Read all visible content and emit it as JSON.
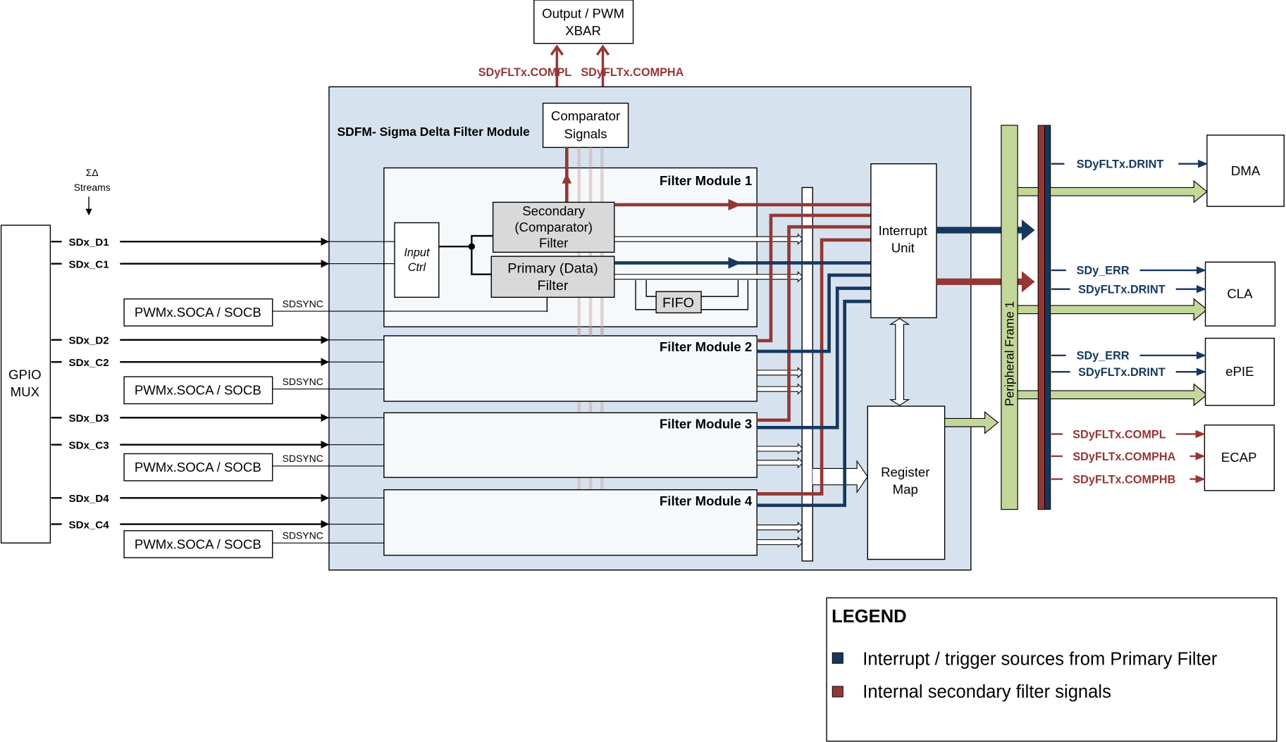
{
  "colors": {
    "interrupt_blue": "#17375e",
    "secondary_red": "#953735",
    "peripheral_green": "#c4d79b",
    "sdfm_background": "#d6e3ef",
    "filter_module_background": "#f5f9fb",
    "filter_box_gray": "#d9d9d9"
  },
  "top": {
    "xbar_line1": "Output / PWM",
    "xbar_line2": "XBAR",
    "compl_label": "SDyFLTx.COMPL",
    "compha_label": "SDyFLTx.COMPHA"
  },
  "inputs": {
    "streams_symbol": "ΣΔ",
    "streams_label": "Streams",
    "gpio_line1": "GPIO",
    "gpio_line2": "MUX",
    "channels": [
      {
        "data": "SDx_D1",
        "clock": "SDx_C1"
      },
      {
        "data": "SDx_D2",
        "clock": "SDx_C2"
      },
      {
        "data": "SDx_D3",
        "clock": "SDx_C3"
      },
      {
        "data": "SDx_D4",
        "clock": "SDx_C4"
      }
    ],
    "pwm_label": "PWMx.SOCA / SOCB",
    "sync_label": "SDSYNC"
  },
  "sdfm": {
    "title": "SDFM- Sigma Delta Filter Module",
    "comparator_line1": "Comparator",
    "comparator_line2": "Signals",
    "filter_modules": [
      "Filter Module 1",
      "Filter Module 2",
      "Filter Module 3",
      "Filter Module 4"
    ],
    "input_ctrl_line1": "Input",
    "input_ctrl_line2": "Ctrl",
    "secondary_line1": "Secondary",
    "secondary_line2": "(Comparator)",
    "secondary_line3": "Filter",
    "primary_line1": "Primary (Data)",
    "primary_line2": "Filter",
    "fifo": "FIFO",
    "interrupt_line1": "Interrupt",
    "interrupt_line2": "Unit",
    "register_line1": "Register",
    "register_line2": "Map"
  },
  "peripheral_frame": "Peripheral Frame 1",
  "destinations": {
    "dma": {
      "name": "DMA",
      "signals": [
        "SDyFLTx.DRINT"
      ]
    },
    "cla": {
      "name": "CLA",
      "signals": [
        "SDy_ERR",
        "SDyFLTx.DRINT"
      ]
    },
    "epie": {
      "name": "ePIE",
      "signals": [
        "SDy_ERR",
        "SDyFLTx.DRINT"
      ]
    },
    "ecap": {
      "name": "ECAP",
      "signals": [
        "SDyFLTx.COMPL",
        "SDyFLTx.COMPHA",
        "SDyFLTx.COMPHB"
      ]
    }
  },
  "legend": {
    "title": "LEGEND",
    "items": [
      {
        "label": "Interrupt / trigger sources from Primary Filter",
        "color": "#17375e"
      },
      {
        "label": "Internal secondary filter signals",
        "color": "#953735"
      }
    ]
  }
}
